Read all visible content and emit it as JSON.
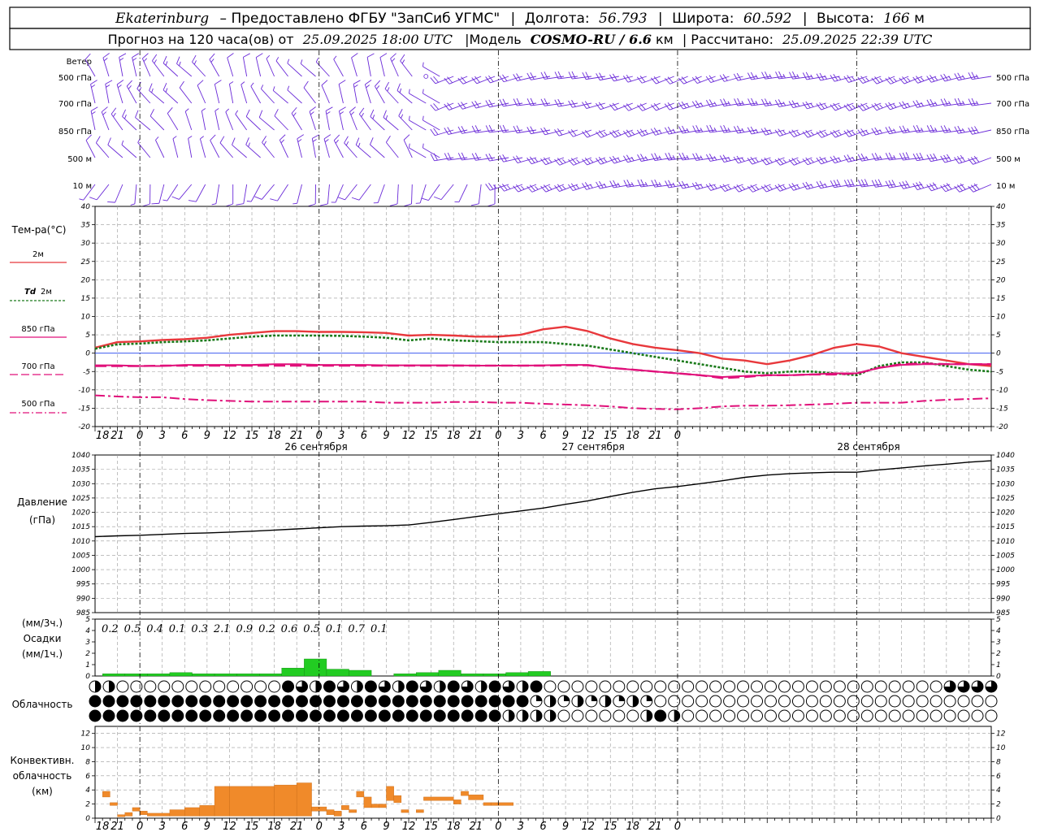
{
  "header": {
    "station": "Ekaterinburg",
    "provider": "– Предоставлено ФГБУ \"ЗапСиб УГМС\"",
    "lon_label": "Долгота:",
    "lon_value": "56.793",
    "lat_label": "Широта:",
    "lat_value": "60.592",
    "alt_label": "Высота:",
    "alt_value": "166",
    "alt_unit": "м",
    "forecast_prefix": "Прогноз на 120 часа(ов)  от",
    "forecast_start": "25.09.2025 18:00 UTC",
    "model_label": "|Модель",
    "model_name": "COSMO-RU / 6.6",
    "model_unit": "км",
    "calc_label": "| Рассчитано:",
    "calc_time": "25.09.2025 22:39 UTC"
  },
  "colors": {
    "wind": "#6a2ad8",
    "t2m": "#e8383c",
    "td2m": "#1a7a1a",
    "t850": "#e0107a",
    "t700": "#e0107a",
    "t500": "#e0107a",
    "pressure": "#000000",
    "precip": "#22cc22",
    "convective": "#f08a2a",
    "zero_line": "#2244ee",
    "grid": "#999999"
  },
  "wind_panel": {
    "title": "Ветер",
    "levels": [
      "500 гПа",
      "700 гПа",
      "850 гПа",
      "500 м",
      "10   м"
    ]
  },
  "temp_panel": {
    "title": "Тем-ра(°C)",
    "legend": [
      {
        "key": "t2m",
        "label": "2м"
      },
      {
        "key": "td2m",
        "label_sym": "Td",
        "label": "2м"
      },
      {
        "key": "t850",
        "label": "850 гПа"
      },
      {
        "key": "t700",
        "label": "700 гПа"
      },
      {
        "key": "t500",
        "label": "500 гПа"
      }
    ]
  },
  "pressure_panel": {
    "title_1": "Давление",
    "title_2": "(гПа)"
  },
  "precip_panel": {
    "title_1": "(мм/3ч.)",
    "title_2": "Осадки",
    "title_3": "(мм/1ч.)",
    "three_hour_totals": [
      "0.2",
      "0.5",
      "0.4",
      "0.1",
      "0.3",
      "2.1",
      "0.9",
      "0.2",
      "0.6",
      "0.5",
      "0.1",
      "0.7",
      "0.1"
    ]
  },
  "cloud_panel": {
    "title": "Облачность"
  },
  "conv_panel": {
    "title_1": "Конвективн.",
    "title_2": "облачность",
    "title_3": "(км)"
  },
  "x_axis": {
    "hour_labels": [
      "18",
      "21",
      "0",
      "3",
      "6",
      "9",
      "12",
      "15",
      "18",
      "21",
      "0",
      "3",
      "6",
      "9",
      "12",
      "15",
      "18",
      "21",
      "0",
      "3",
      "6",
      "9",
      "12",
      "15",
      "18",
      "21",
      "0"
    ],
    "day_labels": [
      "26 сентября",
      "27 сентября",
      "28 сентября"
    ]
  },
  "chart_data": [
    {
      "type": "line",
      "panel": "temperature",
      "x_hours": [
        0,
        3,
        6,
        9,
        12,
        15,
        18,
        21,
        24,
        27,
        30,
        33,
        36,
        39,
        42,
        45,
        48,
        51,
        54,
        57,
        60,
        63,
        66,
        69,
        72,
        75,
        78,
        81,
        84,
        87,
        90,
        93,
        96,
        99,
        102,
        105,
        108,
        111,
        114,
        117,
        120
      ],
      "ylim": [
        -20,
        40
      ],
      "yticks": [
        -20,
        -15,
        -10,
        -5,
        0,
        5,
        10,
        15,
        20,
        25,
        30,
        35,
        40
      ],
      "series": [
        {
          "key": "t2m",
          "values": [
            1.5,
            3.0,
            3.2,
            3.6,
            3.8,
            4.2,
            5.0,
            5.5,
            6.0,
            6.0,
            5.8,
            5.8,
            5.7,
            5.5,
            4.8,
            5.0,
            4.8,
            4.5,
            4.5,
            5.0,
            6.5,
            7.2,
            6.0,
            4.0,
            2.5,
            1.5,
            0.8,
            0.0,
            -1.5,
            -2.0,
            -3.0,
            -2.0,
            -0.5,
            1.5,
            2.5,
            1.8,
            0.0,
            -1.0,
            -2.0,
            -3.0,
            -3.5
          ]
        },
        {
          "key": "td2m",
          "values": [
            1.2,
            2.4,
            2.6,
            3.0,
            3.2,
            3.5,
            4.0,
            4.5,
            4.8,
            4.8,
            4.8,
            4.7,
            4.5,
            4.2,
            3.5,
            4.0,
            3.5,
            3.3,
            3.0,
            3.0,
            3.0,
            2.5,
            2.0,
            1.0,
            0.0,
            -1.0,
            -2.0,
            -3.0,
            -4.0,
            -5.0,
            -5.5,
            -5.0,
            -5.0,
            -5.5,
            -6.0,
            -3.5,
            -2.5,
            -2.5,
            -3.5,
            -4.5,
            -5.0
          ]
        },
        {
          "key": "t850",
          "values": [
            -3.3,
            -3.3,
            -3.5,
            -3.5,
            -3.2,
            -3.2,
            -3.2,
            -3.2,
            -3.0,
            -3.0,
            -3.2,
            -3.2,
            -3.2,
            -3.3,
            -3.3,
            -3.3,
            -3.3,
            -3.4,
            -3.4,
            -3.4,
            -3.3,
            -3.2,
            -3.2,
            -4.0,
            -4.5,
            -5.0,
            -5.5,
            -6.0,
            -6.5,
            -6.2,
            -6.0,
            -6.0,
            -5.8,
            -5.5,
            -5.5,
            -4.0,
            -3.2,
            -3.0,
            -3.0,
            -3.0,
            -3.0
          ]
        },
        {
          "key": "t700",
          "values": [
            -3.5,
            -3.5,
            -3.5,
            -3.4,
            -3.4,
            -3.4,
            -3.4,
            -3.4,
            -3.4,
            -3.4,
            -3.4,
            -3.4,
            -3.4,
            -3.4,
            -3.4,
            -3.4,
            -3.4,
            -3.4,
            -3.4,
            -3.4,
            -3.4,
            -3.3,
            -3.3,
            -4.0,
            -4.5,
            -5.0,
            -5.5,
            -6.0,
            -6.8,
            -6.5,
            -6.0,
            -6.0,
            -5.8,
            -5.8,
            -5.5,
            -4.0,
            -3.0,
            -2.8,
            -3.0,
            -3.0,
            -3.0
          ]
        },
        {
          "key": "t500",
          "values": [
            -11.5,
            -11.8,
            -12.0,
            -12.0,
            -12.5,
            -12.8,
            -13.0,
            -13.2,
            -13.2,
            -13.2,
            -13.2,
            -13.2,
            -13.2,
            -13.5,
            -13.5,
            -13.5,
            -13.3,
            -13.3,
            -13.5,
            -13.5,
            -13.8,
            -14.0,
            -14.2,
            -14.5,
            -15.0,
            -15.2,
            -15.3,
            -15.0,
            -14.5,
            -14.3,
            -14.3,
            -14.2,
            -14.0,
            -13.8,
            -13.5,
            -13.5,
            -13.5,
            -13.0,
            -12.7,
            -12.5,
            -12.3
          ]
        }
      ]
    },
    {
      "type": "line",
      "panel": "pressure",
      "x_hours": [
        0,
        3,
        6,
        9,
        12,
        15,
        18,
        21,
        24,
        27,
        30,
        33,
        36,
        39,
        42,
        45,
        48,
        51,
        54,
        57,
        60,
        63,
        66,
        69,
        72,
        75,
        78,
        81,
        84,
        87,
        90,
        93,
        96,
        99,
        102,
        105,
        108,
        111,
        114,
        117,
        120
      ],
      "ylim": [
        985,
        1040
      ],
      "yticks": [
        985,
        990,
        995,
        1000,
        1005,
        1010,
        1015,
        1020,
        1025,
        1030,
        1035,
        1040
      ],
      "series": [
        {
          "key": "pressure",
          "values": [
            1011.5,
            1011.8,
            1012.0,
            1012.3,
            1012.6,
            1012.8,
            1013.1,
            1013.4,
            1013.8,
            1014.2,
            1014.6,
            1015.0,
            1015.2,
            1015.3,
            1015.6,
            1016.5,
            1017.5,
            1018.5,
            1019.5,
            1020.5,
            1021.5,
            1022.8,
            1024.0,
            1025.5,
            1027.0,
            1028.2,
            1029.0,
            1030.0,
            1031.0,
            1032.2,
            1033.0,
            1033.5,
            1033.8,
            1034.0,
            1034.0,
            1034.8,
            1035.5,
            1036.2,
            1036.8,
            1037.5,
            1038.0
          ]
        }
      ]
    },
    {
      "type": "bar",
      "panel": "precipitation_1h",
      "ylim": [
        0,
        5
      ],
      "yticks": [
        0,
        1,
        2,
        3,
        4,
        5
      ],
      "x_start_hours": [
        1,
        4,
        7,
        10,
        13,
        16,
        19,
        22,
        25,
        28,
        31,
        34,
        37,
        40,
        43,
        46,
        49,
        52,
        55,
        58
      ],
      "values": [
        0.2,
        0.2,
        0.2,
        0.3,
        0.2,
        0.2,
        0.2,
        0.2,
        0.7,
        1.5,
        0.6,
        0.5,
        0.0,
        0.2,
        0.3,
        0.5,
        0.2,
        0.2,
        0.3,
        0.4
      ]
    },
    {
      "type": "bar",
      "panel": "convective_cloud",
      "ylim": [
        0,
        13
      ],
      "yticks": [
        0,
        2,
        4,
        6,
        8,
        10,
        12
      ],
      "segments": [
        {
          "x0": 1,
          "x1": 2,
          "bottom": 3.0,
          "top": 3.8
        },
        {
          "x0": 2,
          "x1": 3,
          "bottom": 1.8,
          "top": 2.2
        },
        {
          "x0": 3,
          "x1": 4,
          "bottom": 0.2,
          "top": 0.5
        },
        {
          "x0": 4,
          "x1": 5,
          "bottom": 0.3,
          "top": 0.8
        },
        {
          "x0": 5,
          "x1": 6,
          "bottom": 1.0,
          "top": 1.5
        },
        {
          "x0": 6,
          "x1": 7,
          "bottom": 0.5,
          "top": 1.0
        },
        {
          "x0": 7,
          "x1": 10,
          "bottom": 0.3,
          "top": 0.7
        },
        {
          "x0": 10,
          "x1": 12,
          "bottom": 0.3,
          "top": 1.2
        },
        {
          "x0": 12,
          "x1": 14,
          "bottom": 0.3,
          "top": 1.5
        },
        {
          "x0": 14,
          "x1": 16,
          "bottom": 0.3,
          "top": 1.8
        },
        {
          "x0": 16,
          "x1": 18,
          "bottom": 0.3,
          "top": 4.5
        },
        {
          "x0": 18,
          "x1": 24,
          "bottom": 0.3,
          "top": 4.5
        },
        {
          "x0": 24,
          "x1": 27,
          "bottom": 0.3,
          "top": 4.7
        },
        {
          "x0": 27,
          "x1": 29,
          "bottom": 0.3,
          "top": 5.0
        },
        {
          "x0": 29,
          "x1": 31,
          "bottom": 1.0,
          "top": 1.6
        },
        {
          "x0": 31,
          "x1": 32,
          "bottom": 0.5,
          "top": 1.2
        },
        {
          "x0": 32,
          "x1": 33,
          "bottom": 0.3,
          "top": 1.0
        },
        {
          "x0": 33,
          "x1": 34,
          "bottom": 1.2,
          "top": 1.8
        },
        {
          "x0": 34,
          "x1": 35,
          "bottom": 0.8,
          "top": 1.2
        },
        {
          "x0": 35,
          "x1": 36,
          "bottom": 3.0,
          "top": 3.8
        },
        {
          "x0": 36,
          "x1": 37,
          "bottom": 1.5,
          "top": 3.0
        },
        {
          "x0": 37,
          "x1": 38,
          "bottom": 1.5,
          "top": 2.0
        },
        {
          "x0": 38,
          "x1": 39,
          "bottom": 1.5,
          "top": 2.0
        },
        {
          "x0": 39,
          "x1": 40,
          "bottom": 2.5,
          "top": 4.5
        },
        {
          "x0": 40,
          "x1": 41,
          "bottom": 2.2,
          "top": 3.2
        },
        {
          "x0": 41,
          "x1": 42,
          "bottom": 0.8,
          "top": 1.2
        },
        {
          "x0": 43,
          "x1": 44,
          "bottom": 0.8,
          "top": 1.2
        },
        {
          "x0": 44,
          "x1": 48,
          "bottom": 2.5,
          "top": 3.0
        },
        {
          "x0": 48,
          "x1": 49,
          "bottom": 2.0,
          "top": 2.6
        },
        {
          "x0": 49,
          "x1": 50,
          "bottom": 3.2,
          "top": 3.8
        },
        {
          "x0": 50,
          "x1": 52,
          "bottom": 2.6,
          "top": 3.3
        },
        {
          "x0": 52,
          "x1": 53,
          "bottom": 1.8,
          "top": 2.2
        },
        {
          "x0": 53,
          "x1": 56,
          "bottom": 1.8,
          "top": 2.2
        }
      ]
    }
  ]
}
